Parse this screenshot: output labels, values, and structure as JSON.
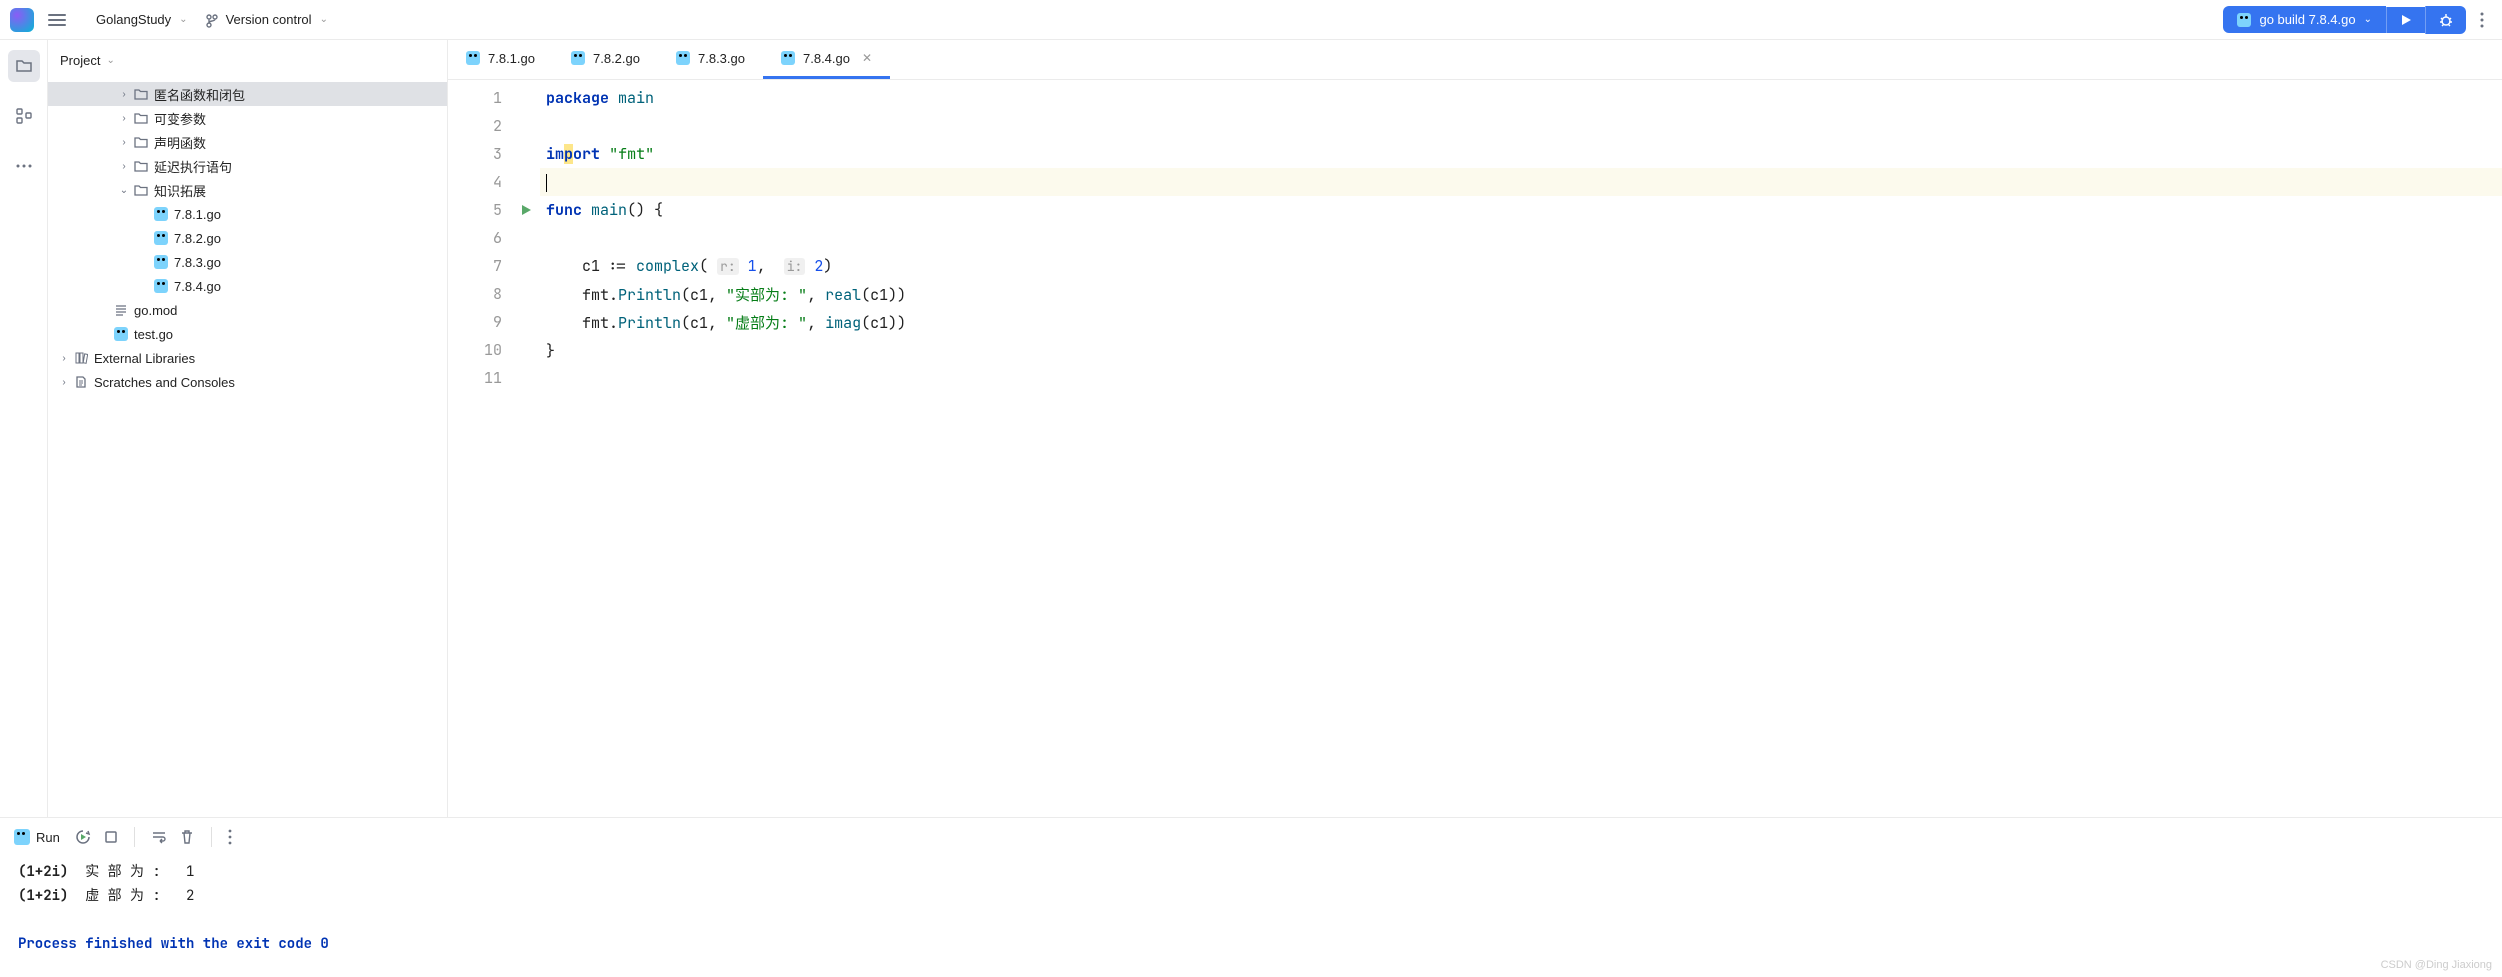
{
  "toolbar": {
    "project_name": "GolangStudy",
    "vcs_label": "Version control",
    "run_config_label": "go build 7.8.4.go"
  },
  "sidebar": {
    "title": "Project",
    "tree": [
      {
        "depth": 3,
        "arrow": "right",
        "icon": "folder",
        "label": "匿名函数和闭包",
        "selected": true
      },
      {
        "depth": 3,
        "arrow": "right",
        "icon": "folder",
        "label": "可变参数"
      },
      {
        "depth": 3,
        "arrow": "right",
        "icon": "folder",
        "label": "声明函数"
      },
      {
        "depth": 3,
        "arrow": "right",
        "icon": "folder",
        "label": "延迟执行语句"
      },
      {
        "depth": 3,
        "arrow": "down",
        "icon": "folder",
        "label": "知识拓展"
      },
      {
        "depth": 4,
        "arrow": "none",
        "icon": "go",
        "label": "7.8.1.go"
      },
      {
        "depth": 4,
        "arrow": "none",
        "icon": "go",
        "label": "7.8.2.go"
      },
      {
        "depth": 4,
        "arrow": "none",
        "icon": "go",
        "label": "7.8.3.go"
      },
      {
        "depth": 4,
        "arrow": "none",
        "icon": "go",
        "label": "7.8.4.go"
      },
      {
        "depth": 2,
        "arrow": "none",
        "icon": "mod",
        "label": "go.mod"
      },
      {
        "depth": 2,
        "arrow": "none",
        "icon": "go",
        "label": "test.go"
      },
      {
        "depth": 0,
        "arrow": "right",
        "icon": "lib",
        "label": "External Libraries"
      },
      {
        "depth": 0,
        "arrow": "right",
        "icon": "scratch",
        "label": "Scratches and Consoles"
      }
    ]
  },
  "tabs": [
    {
      "label": "7.8.1.go",
      "active": false
    },
    {
      "label": "7.8.2.go",
      "active": false
    },
    {
      "label": "7.8.3.go",
      "active": false
    },
    {
      "label": "7.8.4.go",
      "active": true
    }
  ],
  "editor": {
    "lines": [
      {
        "n": 1,
        "html": "<span class='kw'>package</span> <span class='pkg'>main</span>"
      },
      {
        "n": 2,
        "html": ""
      },
      {
        "n": 3,
        "html": "<span class='kw'>im<span style='background:#fde68a'>p</span>ort</span> <span class='str'>\"fmt\"</span>"
      },
      {
        "n": 4,
        "html": "<span class='cursor'></span>",
        "hl": true
      },
      {
        "n": 5,
        "html": "<span class='kw'>func</span> <span class='fn'>main</span>() {",
        "play": true
      },
      {
        "n": 6,
        "html": ""
      },
      {
        "n": 7,
        "html": "    c1 := <span class='fn'>complex</span>( <span class='hint'>r:</span> <span class='num'>1</span>,  <span class='hint'>i:</span> <span class='num'>2</span>)"
      },
      {
        "n": 8,
        "html": "    fmt.<span class='fn'>Println</span>(c1, <span class='str'>\"实部为: \"</span>, <span class='fn'>real</span>(c1))"
      },
      {
        "n": 9,
        "html": "    fmt.<span class='fn'>Println</span>(c1, <span class='str'>\"虚部为: \"</span>, <span class='fn'>imag</span>(c1))"
      },
      {
        "n": 10,
        "html": "}"
      },
      {
        "n": 11,
        "html": ""
      }
    ]
  },
  "run_panel": {
    "title": "Run",
    "output_lines": [
      {
        "html": "<span class='out-bold'>(1+2i)</span>  实 部 为 :   1"
      },
      {
        "html": "<span class='out-bold'>(1+2i)</span>  虚 部 为 :   2"
      },
      {
        "html": ""
      },
      {
        "html": "<span class='out-exit'>Process finished with the exit code 0</span>"
      }
    ]
  },
  "watermark": "CSDN @Ding Jiaxiong"
}
